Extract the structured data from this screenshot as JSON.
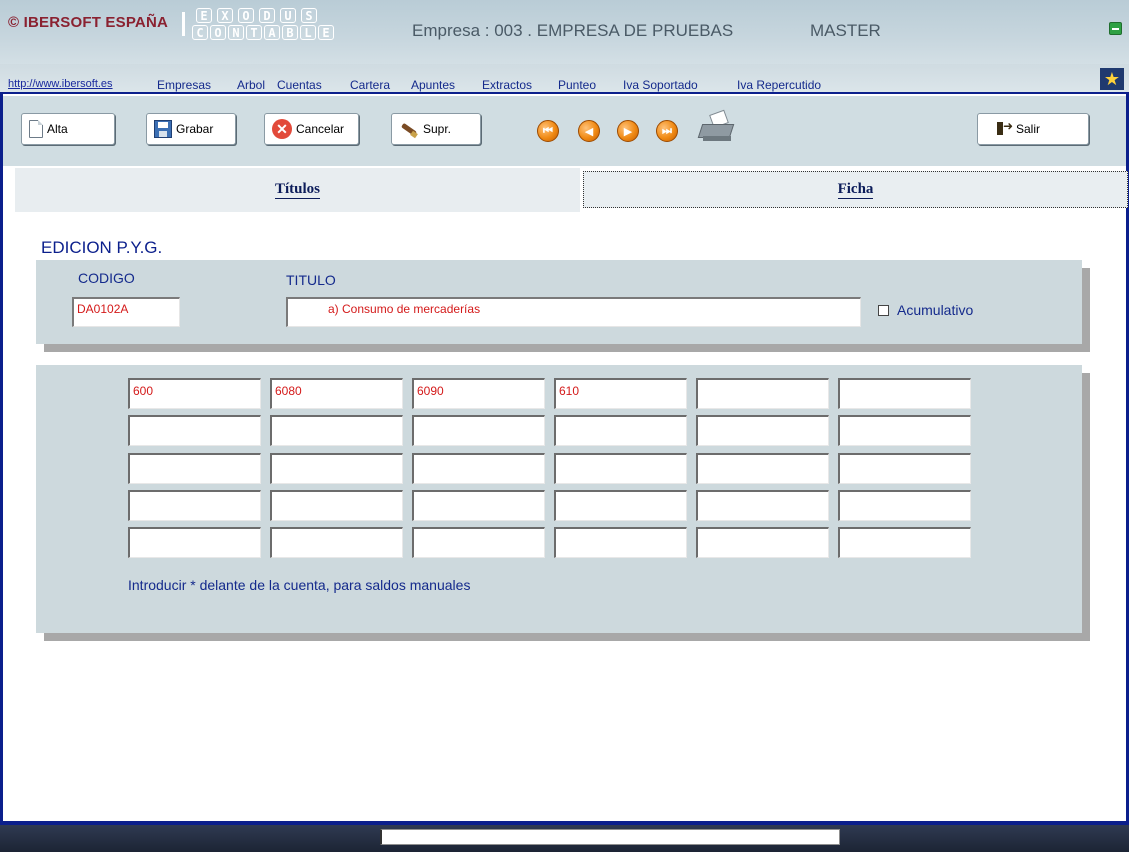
{
  "header": {
    "brand": "© IBERSOFT ESPAÑA",
    "logo_top": [
      "E",
      "X",
      "O",
      "D",
      "U",
      "S"
    ],
    "logo_bottom": [
      "C",
      "O",
      "N",
      "T",
      "A",
      "B",
      "L",
      "E"
    ],
    "empresa": "Empresa : 003 . EMPRESA DE PRUEBAS",
    "master": "MASTER"
  },
  "menu": {
    "link": "http://www.ibersoft.es",
    "items": [
      "Empresas",
      "Arbol",
      "Cuentas",
      "Cartera",
      "Apuntes",
      "Extractos",
      "Punteo",
      "Iva Soportado",
      "Iva Repercutido"
    ]
  },
  "toolbar": {
    "alta": "Alta",
    "grabar": "Grabar",
    "cancelar": "Cancelar",
    "suprimir": "Supr.",
    "salir": "Salir"
  },
  "tabs": {
    "titulos": "Títulos",
    "ficha": "Ficha"
  },
  "form": {
    "section_title": "EDICION P.Y.G.",
    "codigo_label": "CODIGO",
    "titulo_label": "TITULO",
    "codigo_value": "DA0102A",
    "titulo_value": "a) Consumo de mercaderías",
    "acumulativo_label": "Acumulativo",
    "acumulativo_checked": false
  },
  "grid": {
    "rows": [
      [
        "600",
        "6080",
        "6090",
        "610",
        "",
        ""
      ],
      [
        "",
        "",
        "",
        "",
        "",
        ""
      ],
      [
        "",
        "",
        "",
        "",
        "",
        ""
      ],
      [
        "",
        "",
        "",
        "",
        "",
        ""
      ],
      [
        "",
        "",
        "",
        "",
        "",
        ""
      ]
    ],
    "note": "Introducir * delante de la cuenta, para saldos manuales"
  },
  "colors": {
    "accent": "#0b1f8c",
    "value_text": "#d41a1a",
    "panel": "#cdd9dd"
  }
}
